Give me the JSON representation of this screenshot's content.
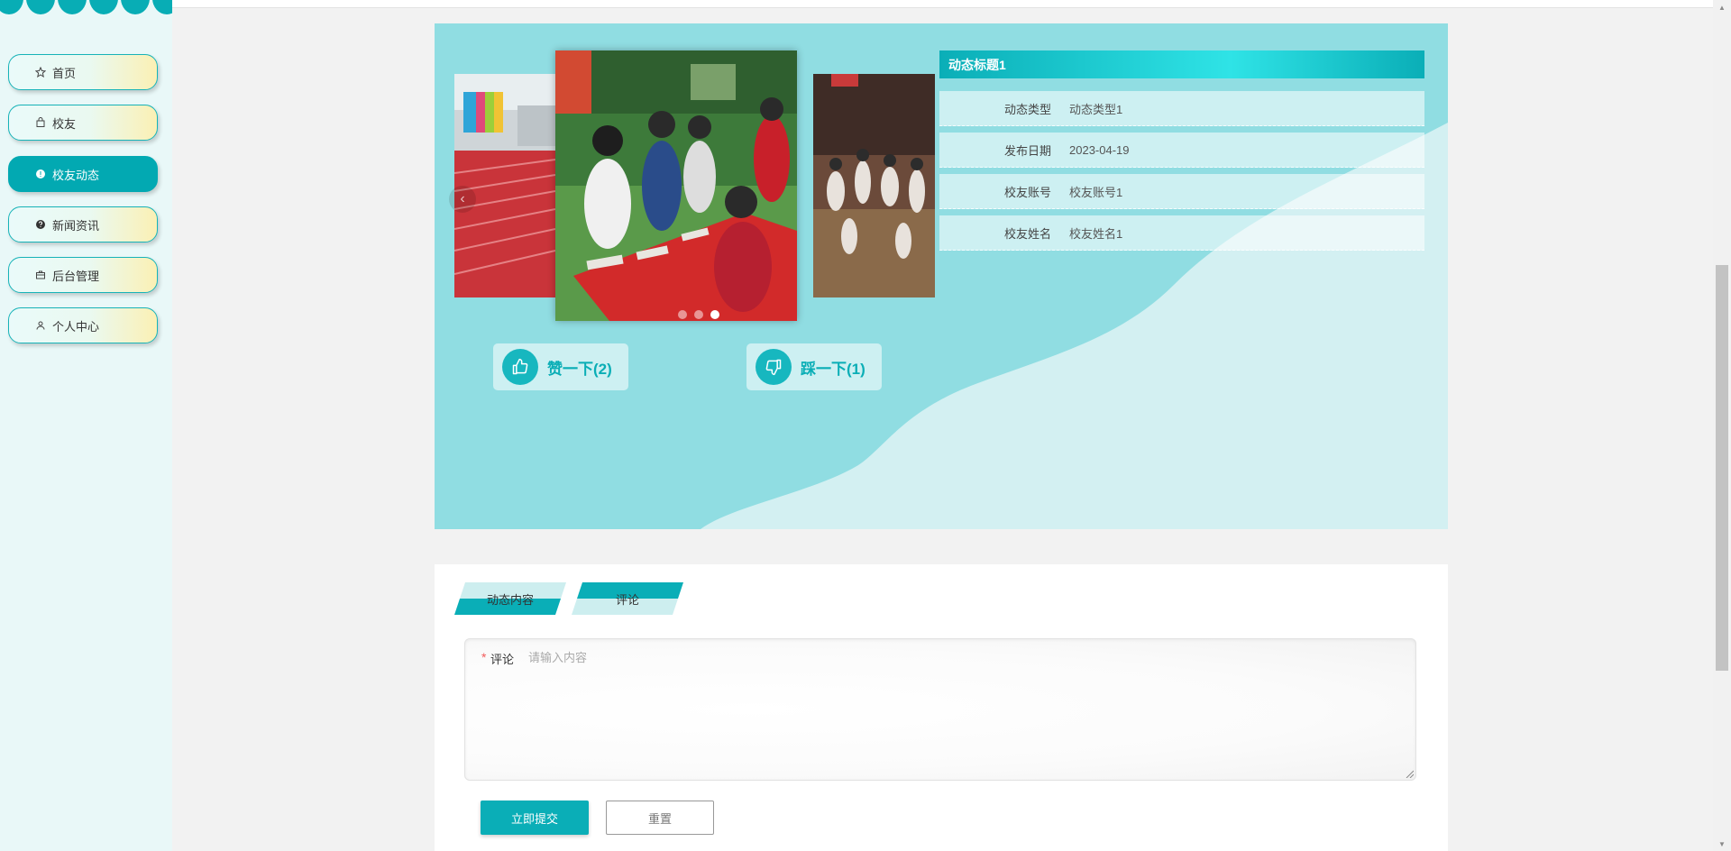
{
  "sidebar": {
    "items": [
      {
        "label": "首页",
        "icon": "star-icon"
      },
      {
        "label": "校友",
        "icon": "bag-icon"
      },
      {
        "label": "校友动态",
        "icon": "info-circle-icon",
        "active": true
      },
      {
        "label": "新闻资讯",
        "icon": "question-circle-icon"
      },
      {
        "label": "后台管理",
        "icon": "briefcase-icon"
      },
      {
        "label": "个人中心",
        "icon": "user-icon"
      }
    ]
  },
  "detail": {
    "title": "动态标题1",
    "fields": [
      {
        "label": "动态类型",
        "value": "动态类型1"
      },
      {
        "label": "发布日期",
        "value": "2023-04-19"
      },
      {
        "label": "校友账号",
        "value": "校友账号1"
      },
      {
        "label": "校友姓名",
        "value": "校友姓名1"
      }
    ],
    "like_label": "赞一下(2)",
    "dislike_label": "踩一下(1)",
    "carousel_active_index": 2,
    "carousel_count": 3
  },
  "tabs": [
    {
      "label": "动态内容"
    },
    {
      "label": "评论",
      "active": true
    }
  ],
  "comment_form": {
    "label": "评论",
    "required_mark": "*",
    "placeholder": "请输入内容",
    "value": "",
    "submit_label": "立即提交",
    "reset_label": "重置"
  },
  "colors": {
    "accent": "#0aaeb7",
    "hero_bg": "#90dde2",
    "sidebar_bg": "#e9f8f8",
    "nav_gradient_end": "#fbf0b4"
  }
}
